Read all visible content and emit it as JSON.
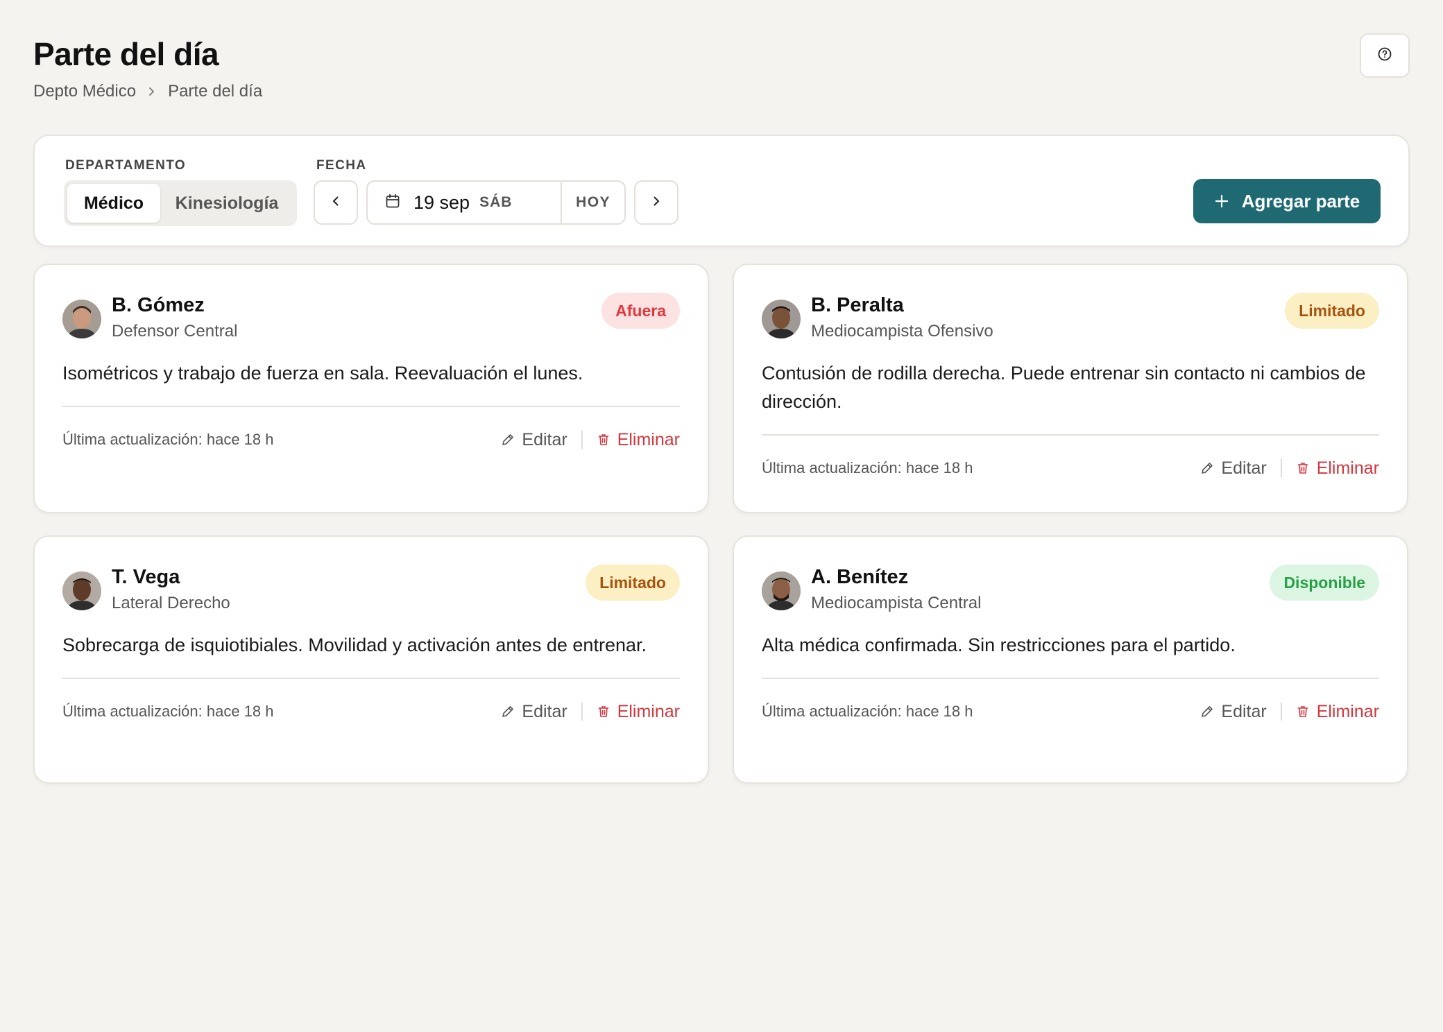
{
  "header": {
    "title": "Parte del día",
    "breadcrumb": [
      "Depto Médico",
      "Parte del día"
    ]
  },
  "toolbar": {
    "department_label": "DEPARTAMENTO",
    "departments": [
      "Médico",
      "Kinesiología"
    ],
    "active_department": "Médico",
    "date_label": "FECHA",
    "date": "19 sep",
    "day_of_week": "SÁB",
    "today_label": "HOY",
    "add_label": "Agregar parte"
  },
  "cards": [
    {
      "name": "B. Gómez",
      "position": "Defensor Central",
      "status": "Afuera",
      "status_color": "#e0383e",
      "status_bg": "#fde2e2",
      "note": "Isométricos y trabajo de fuerza en sala. Reevaluación el lunes.",
      "updated": "Última actualización: hace 18 h",
      "edit_label": "Editar",
      "delete_label": "Eliminar"
    },
    {
      "name": "B. Peralta",
      "position": "Mediocampista Ofensivo",
      "status": "Limitado",
      "status_color": "#a5540d",
      "status_bg": "#fcefc4",
      "note": "Contusión de rodilla derecha. Puede entrenar sin contacto ni cambios de dirección.",
      "updated": "Última actualización: hace 18 h",
      "edit_label": "Editar",
      "delete_label": "Eliminar"
    },
    {
      "name": "T. Vega",
      "position": "Lateral Derecho",
      "status": "Limitado",
      "status_color": "#a5540d",
      "status_bg": "#fcefc4",
      "note": "Sobrecarga de isquiotibiales. Movilidad y activación antes de entrenar.",
      "updated": "Última actualización: hace 18 h",
      "edit_label": "Editar",
      "delete_label": "Eliminar"
    },
    {
      "name": "A. Benítez",
      "position": "Mediocampista Central",
      "status": "Disponible",
      "status_color": "#27a046",
      "status_bg": "#dcf5e3",
      "note": "Alta médica confirmada. Sin restricciones para el partido.",
      "updated": "Última actualización: hace 18 h",
      "edit_label": "Editar",
      "delete_label": "Eliminar"
    }
  ],
  "colors": {
    "accent": "#1f6a72",
    "danger": "#d3363c",
    "background": "#f5f3ef"
  },
  "icons": [
    "help-icon",
    "calendar-icon",
    "chevron-left-icon",
    "chevron-right-icon",
    "plus-icon",
    "pencil-icon",
    "trash-icon"
  ]
}
